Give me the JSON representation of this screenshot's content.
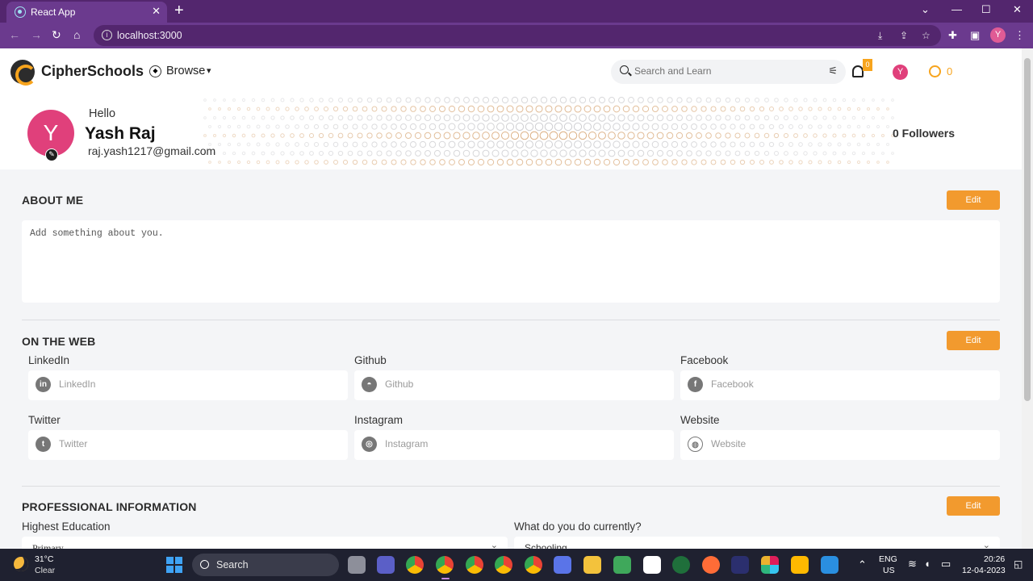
{
  "browser": {
    "tab_title": "React App",
    "tab_close": "✕",
    "new_tab": "+",
    "url": "localhost:3000",
    "avatar_letter": "Y"
  },
  "nav": {
    "brand": "CipherSchools",
    "browse": "Browse",
    "search_placeholder": "Search and Learn",
    "notification_count": "0",
    "avatar_letter": "Y",
    "coins": "0"
  },
  "profile": {
    "avatar_letter": "Y",
    "greeting": "Hello",
    "name": "Yash Raj",
    "email": "raj.yash1217@gmail.com",
    "followers": "0 Followers"
  },
  "about": {
    "title": "ABOUT ME",
    "edit": "Edit",
    "placeholder": "Add something about you."
  },
  "web": {
    "title": "ON THE WEB",
    "edit": "Edit",
    "fields": [
      {
        "label": "LinkedIn",
        "placeholder": "LinkedIn",
        "icon": "linkedin-icon"
      },
      {
        "label": "Github",
        "placeholder": "Github",
        "icon": "github-icon"
      },
      {
        "label": "Facebook",
        "placeholder": "Facebook",
        "icon": "facebook-icon"
      },
      {
        "label": "Twitter",
        "placeholder": "Twitter",
        "icon": "twitter-icon"
      },
      {
        "label": "Instagram",
        "placeholder": "Instagram",
        "icon": "instagram-icon"
      },
      {
        "label": "Website",
        "placeholder": "Website",
        "icon": "globe-icon"
      }
    ]
  },
  "professional": {
    "title": "PROFESSIONAL INFORMATION",
    "edit": "Edit",
    "education_label": "Highest Education",
    "education_value": "Primary",
    "current_label": "What do you do currently?",
    "current_value": "Schooling"
  },
  "taskbar": {
    "temperature": "31°C",
    "weather": "Clear",
    "search": "Search",
    "lang_1": "ENG",
    "lang_2": "US",
    "time": "20:26",
    "date": "12-04-2023"
  },
  "colors": {
    "brand_orange": "#f29a2e",
    "chrome_purple": "#6b3a8e",
    "avatar_pink": "#e0407b"
  }
}
